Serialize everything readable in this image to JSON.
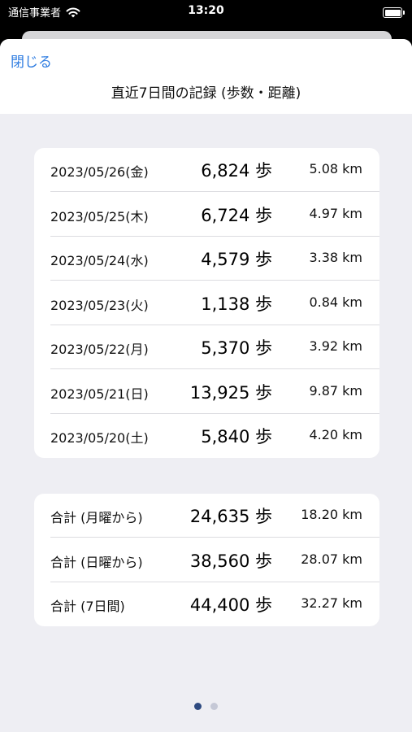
{
  "status": {
    "carrier": "通信事業者",
    "time": "13:20"
  },
  "nav": {
    "close_label": "閉じる",
    "title": "直近7日間の記録 (歩数・距離)"
  },
  "daily": [
    {
      "date": "2023/05/26(金)",
      "steps": "6,824 歩",
      "distance": "5.08 km"
    },
    {
      "date": "2023/05/25(木)",
      "steps": "6,724 歩",
      "distance": "4.97 km"
    },
    {
      "date": "2023/05/24(水)",
      "steps": "4,579 歩",
      "distance": "3.38 km"
    },
    {
      "date": "2023/05/23(火)",
      "steps": "1,138 歩",
      "distance": "0.84 km"
    },
    {
      "date": "2023/05/22(月)",
      "steps": "5,370 歩",
      "distance": "3.92 km"
    },
    {
      "date": "2023/05/21(日)",
      "steps": "13,925 歩",
      "distance": "9.87 km"
    },
    {
      "date": "2023/05/20(土)",
      "steps": "5,840 歩",
      "distance": "4.20 km"
    }
  ],
  "totals": [
    {
      "label": "合計 (月曜から)",
      "steps": "24,635 歩",
      "distance": "18.20 km"
    },
    {
      "label": "合計 (日曜から)",
      "steps": "38,560 歩",
      "distance": "28.07 km"
    },
    {
      "label": "合計 (7日間)",
      "steps": "44,400 歩",
      "distance": "32.27 km"
    }
  ],
  "pager": {
    "current": 1,
    "total": 2
  }
}
